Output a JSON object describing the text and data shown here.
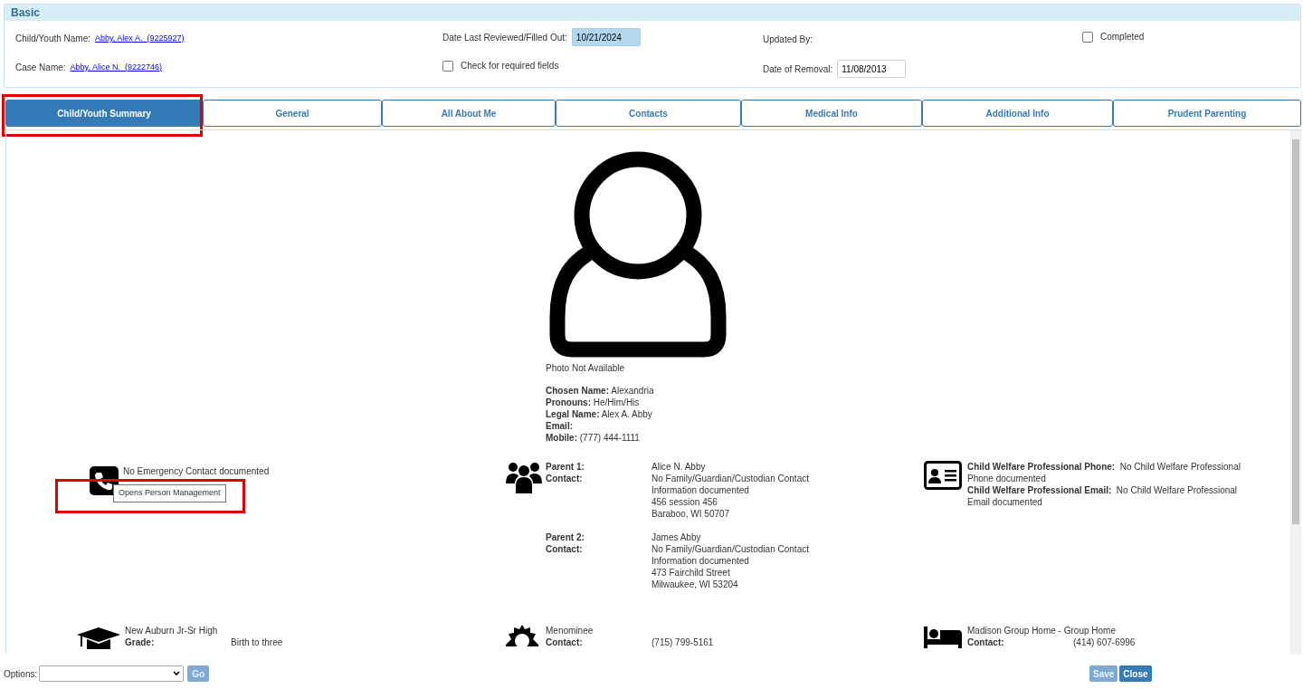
{
  "basic": {
    "title": "Basic",
    "child_label": "Child/Youth Name:",
    "child_link": "Abby, Alex A.  (9225927)",
    "case_label": "Case Name:",
    "case_link": "Abby, Alice N.  (9222746)",
    "reviewed_label": "Date Last Reviewed/Filled Out:",
    "reviewed_value": "10/21/2024",
    "required_check": {
      "label": "Check for required fields",
      "checked": false
    },
    "updated_label": "Updated By:",
    "removal_label": "Date of Removal:",
    "removal_value": "11/08/2013",
    "completed_check": {
      "label": "Completed",
      "checked": false
    }
  },
  "tabs": [
    {
      "label": "Child/Youth Summary",
      "selected": true,
      "highlighted": true
    },
    {
      "label": "General",
      "selected": false,
      "highlighted": false
    },
    {
      "label": "All About Me",
      "selected": false,
      "highlighted": false
    },
    {
      "label": "Contacts",
      "selected": false,
      "highlighted": false
    },
    {
      "label": "Medical Info",
      "selected": false,
      "highlighted": false
    },
    {
      "label": "Additional Info",
      "selected": false,
      "highlighted": false
    },
    {
      "label": "Prudent Parenting",
      "selected": false,
      "highlighted": false
    }
  ],
  "summary": {
    "photo_caption": "Photo Not Available",
    "details": [
      {
        "label": "Chosen Name:",
        "value": "Alexandria"
      },
      {
        "label": "Pronouns:",
        "value": "He/Him/His"
      },
      {
        "label": "Legal Name:",
        "value": "Alex A. Abby"
      },
      {
        "label": "Email:"
      },
      {
        "label": "Mobile:",
        "value": "(777) 444-1111"
      }
    ],
    "emergency": {
      "text": "No Emergency Contact documented",
      "tooltip": "Opens Person Management",
      "highlighted": true
    },
    "parents": [
      {
        "label": "Parent 1:",
        "contact_label": "Contact:",
        "lines": [
          "Alice N. Abby",
          "No Family/Guardian/Custodian Contact Information documented",
          "456 session 456",
          "Baraboo, WI 50707"
        ]
      },
      {
        "label": "Parent 2:",
        "contact_label": "Contact:",
        "lines": [
          "James Abby",
          "No Family/Guardian/Custodian Contact Information documented",
          "473 Fairchild Street",
          "Milwaukee, WI 53204"
        ]
      }
    ],
    "professional": [
      "**Child Welfare Professional Phone:**  No Child Welfare Professional Phone documented",
      "**Child Welfare Professional Email:**  No Child Welfare Professional Email documented"
    ],
    "school": {
      "name": "New Auburn Jr-Sr High",
      "grade_label": "Grade:",
      "grade": "Birth to three"
    },
    "tribe": {
      "name": "Menominee",
      "contact_label": "Contact:",
      "phone": "(715) 799-5161"
    },
    "placement": {
      "name": "Madison Group Home - Group Home",
      "contact_label": "Contact:",
      "phone": "(414) 607-6996"
    }
  },
  "footer": {
    "options_label": "Options:",
    "buttons": [
      {
        "label": "Go",
        "disabled": true
      },
      {
        "label": "Save",
        "disabled": true
      },
      {
        "label": "Close",
        "disabled": false
      }
    ]
  }
}
